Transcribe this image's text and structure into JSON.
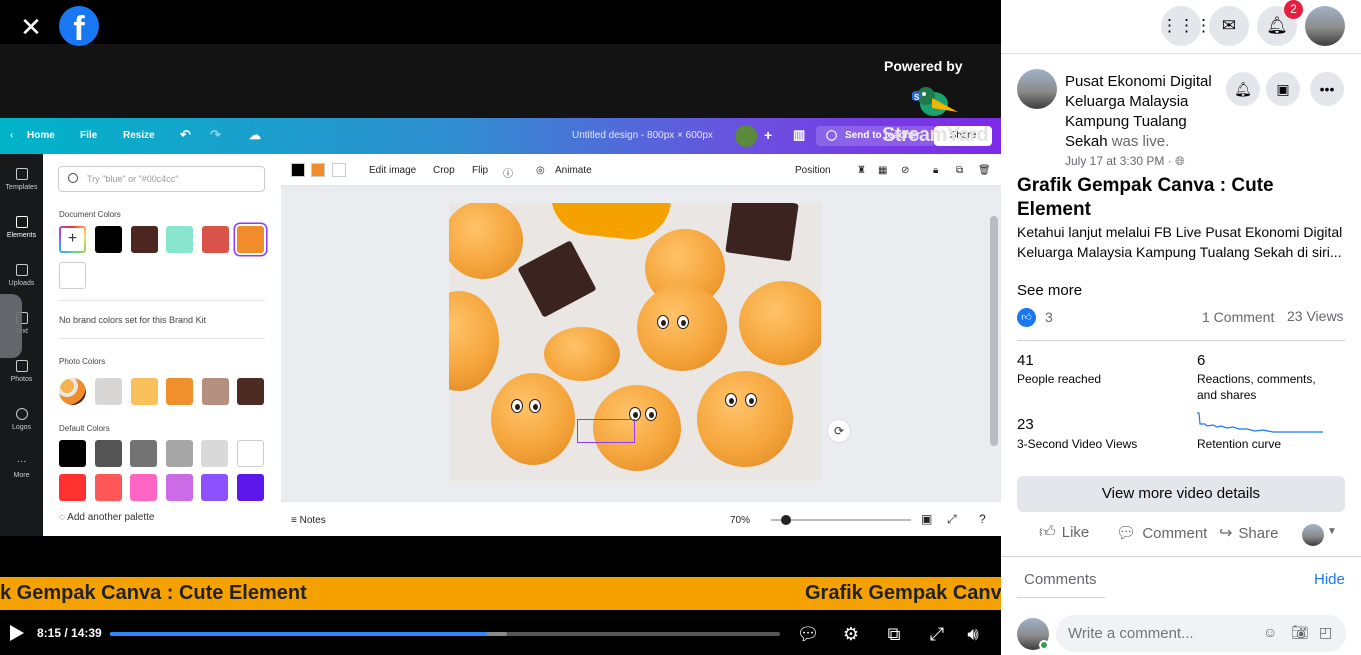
{
  "player": {
    "close_icon": "close-icon",
    "facebook_logo": "facebook-logo",
    "powered_by": "Powered by",
    "streamyard_text": "StreamYard",
    "time": "8:15 / 14:39",
    "progress_fraction": 0.563,
    "buffer_fraction": 0.592,
    "ticker": {
      "text_1": "k Gempak Canva : Cute Element",
      "text_2": "Grafik Gempak Canva"
    }
  },
  "canva": {
    "home": "Home",
    "file": "File",
    "resize": "Resize",
    "title": "Untitled design - 800px × 600px",
    "send": "Send to teacher",
    "share": "Share",
    "sidebar": [
      "Templates",
      "Elements",
      "Uploads",
      "Text",
      "Photos",
      "Logos",
      "More"
    ],
    "search_placeholder": "Try \"blue\" or \"#00c4cc\"",
    "document_colors_label": "Document Colors",
    "no_brand": "No brand colors set for this Brand Kit",
    "photo_colors_label": "Photo Colors",
    "default_colors_label": "Default Colors",
    "add_palette": "Add another palette",
    "document_colors": [
      "#000000",
      "#4d271f",
      "#87e6cd",
      "#d9534a",
      "#f08c2b",
      "#ffffff"
    ],
    "photo_colors": [
      "#d9d6d6",
      "#f9c05c",
      "#ef902d",
      "#b58f80",
      "#4d2a22"
    ],
    "default_colors": [
      "#000000",
      "#545454",
      "#737373",
      "#a6a6a6",
      "#d9d9d9",
      "#ffffff",
      "#ff3131",
      "#ff5757",
      "#ff66c4",
      "#cb6ce6",
      "#8c52ff",
      "#5e17eb"
    ],
    "toolbar": {
      "edit_image": "Edit image",
      "crop": "Crop",
      "flip": "Flip",
      "animate": "Animate",
      "position": "Position"
    },
    "notes": "Notes",
    "zoom": "70%"
  },
  "side": {
    "badge": "2",
    "page_name": "Pusat Ekonomi Digital Keluarga Malaysia Kampung Tualang Sekah",
    "was_live": "was live.",
    "date": "July 17 at 3:30 PM · ",
    "title": "Grafik Gempak Canva : Cute Element",
    "description": "Ketahui lanjut melalui FB Live Pusat Ekonomi Digital Keluarga Malaysia Kampung Tualang Sekah di siri...",
    "see_more": "See more",
    "reactions": "3",
    "comments_count": "1 Comment",
    "views": "23 Views",
    "metrics": {
      "reached_num": "41",
      "reached_label": "People reached",
      "reactions_num": "6",
      "reactions_label": "Reactions, comments, and shares",
      "views3_num": "23",
      "views3_label": "3-Second Video Views",
      "retention_label": "Retention curve"
    },
    "view_more": "View more video details",
    "like": "Like",
    "comment": "Comment",
    "share": "Share",
    "comments_label": "Comments",
    "hide": "Hide",
    "write_placeholder": "Write a comment..."
  }
}
